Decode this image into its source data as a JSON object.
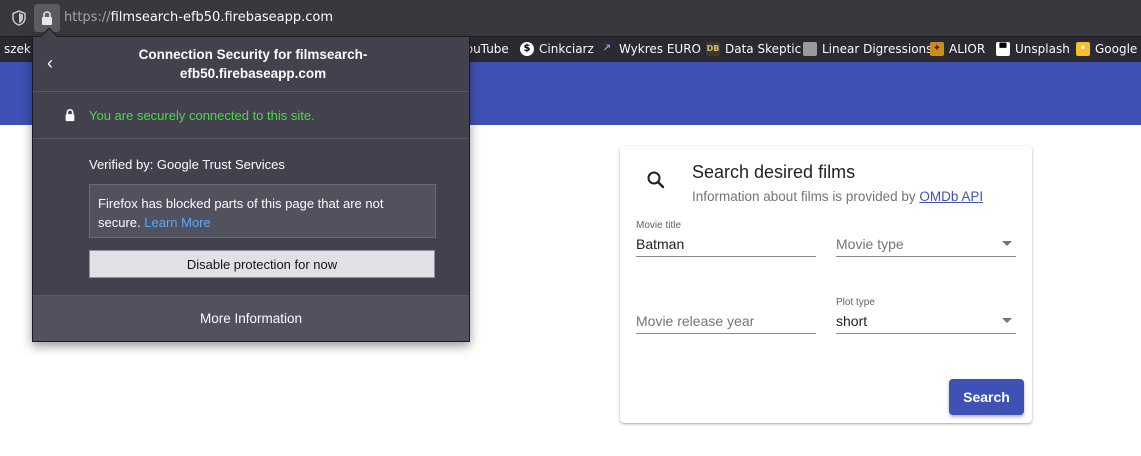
{
  "browser": {
    "url_scheme": "https://",
    "url_host": "filmsearch-efb50.firebaseapp.com"
  },
  "bookmarks": [
    {
      "label": "szek",
      "icon": ""
    },
    {
      "label": "YouTube",
      "icon": "youtube-icon"
    },
    {
      "label": "Cinkciarz",
      "icon": "dollar-icon"
    },
    {
      "label": "Wykres EURO",
      "icon": "chart-icon"
    },
    {
      "label": "Data Skeptic",
      "icon": "db-icon"
    },
    {
      "label": "Linear Digressions",
      "icon": "cube-icon"
    },
    {
      "label": "ALIOR",
      "icon": "alior-icon"
    },
    {
      "label": "Unsplash",
      "icon": "camera-icon"
    },
    {
      "label": "Google K",
      "icon": "keep-icon"
    }
  ],
  "popup": {
    "title_line1": "Connection Security for filmsearch-",
    "title_line2": "efb50.firebaseapp.com",
    "secure_text": "You are securely connected to this site.",
    "verified_by": "Verified by: Google Trust Services",
    "warning_text": "Firefox has blocked parts of this page that are not secure.",
    "learn_more": "Learn More",
    "disable_label": "Disable protection for now",
    "more_info": "More Information"
  },
  "card": {
    "title": "Search desired films",
    "subtitle_prefix": "Information about films is provided by ",
    "subtitle_link": "OMDb API",
    "movie_title_label": "Movie title",
    "movie_title_value": "Batman",
    "movie_type_placeholder": "Movie type",
    "release_year_placeholder": "Movie release year",
    "plot_type_label": "Plot type",
    "plot_type_value": "short",
    "search_button": "Search"
  },
  "colors": {
    "app_bar": "#3f51b5",
    "secure_green": "#4ad84a",
    "link_blue": "#5aa9ff"
  }
}
